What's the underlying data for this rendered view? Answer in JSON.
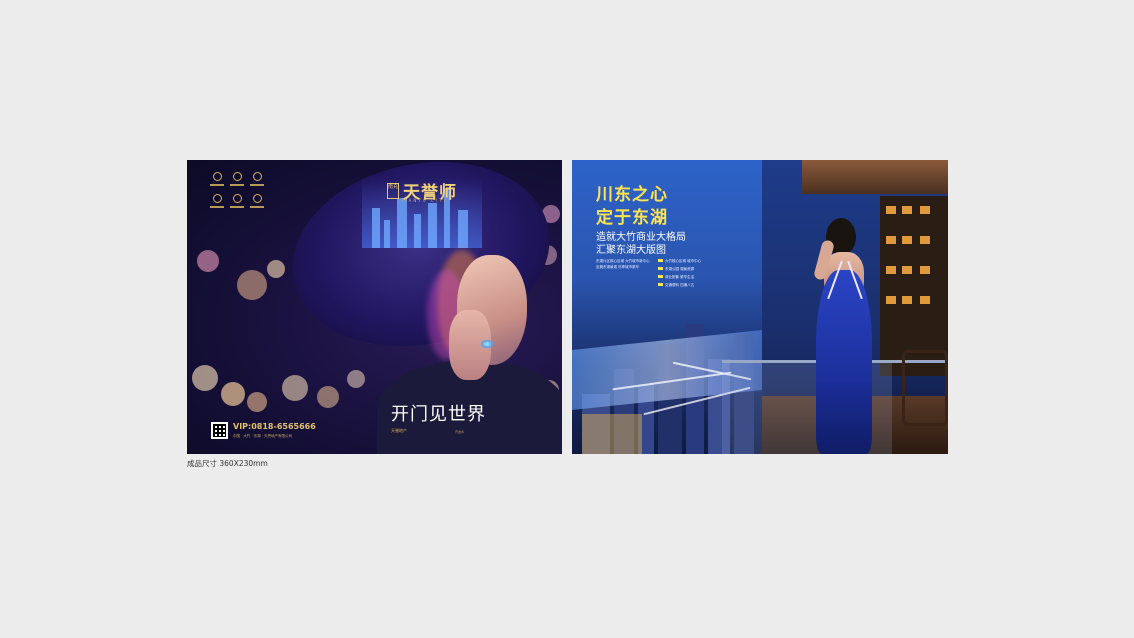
{
  "left_brochure": {
    "brand": {
      "seal": "南充",
      "name": "天誉师",
      "sub": "TIANYU CITY"
    },
    "slogan": "开门见世界",
    "vip": "VIP:0818-6565666",
    "vip_sub": "中国 · 大竹 · 东湖 · 天誉地产有限公司",
    "developer": "天誉地产",
    "developer_sub": "开发商"
  },
  "right_brochure": {
    "title_line1": "川东之心",
    "title_line2": "定于东湖",
    "sub_line1": "造就大竹商业大格局",
    "sub_line2": "汇聚东湖大版图",
    "body": "东湖片区核心区域 大竹城市新中心 坐拥东湖景观 尽享城市繁华",
    "bullets": [
      "大竹核心区域 城市中心",
      "东湖公园 湖景资源",
      "商业配套 繁华生活",
      "交通便利 四通八达"
    ]
  },
  "caption": "成品尺寸  360X230mm",
  "colors": {
    "background": "#ececed",
    "gold": "#f1d27a",
    "title_yellow": "#ffe44d"
  }
}
